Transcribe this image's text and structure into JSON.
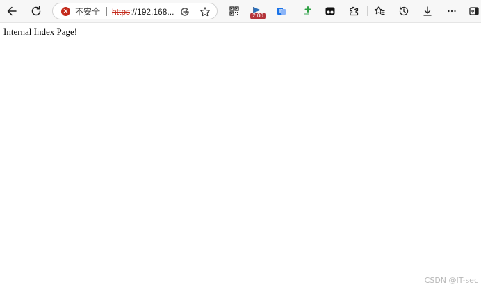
{
  "toolbar": {
    "back_icon": "arrow-left-icon",
    "refresh_icon": "refresh-icon",
    "address_bar": {
      "security_icon": "not-secure-icon",
      "security_label": "不安全",
      "url_scheme": "https",
      "url_rest": "://192.168...",
      "read_aloud_icon": "read-aloud-icon",
      "favorite_icon": "star-icon"
    },
    "extensions": [
      {
        "name": "qr-code-icon"
      },
      {
        "name": "flag-extension-icon",
        "badge": "2.00"
      },
      {
        "name": "translate-extension-icon"
      },
      {
        "name": "puzzle-plus-extension-icon"
      },
      {
        "name": "tampermonkey-icon"
      }
    ],
    "extensions_menu_icon": "puzzle-icon",
    "favorites_icon": "favorites-icon",
    "history_icon": "history-icon",
    "downloads_icon": "download-icon",
    "more_icon": "more-icon",
    "sidebar_icon": "sidebar-icon",
    "colors": {
      "security_red": "#c42b1c",
      "badge_red": "#b4343a",
      "translate_blue": "#1a73e8",
      "plus_green": "#2ea043"
    }
  },
  "page": {
    "body_text": "Internal Index Page!"
  },
  "watermark": "CSDN @IT-sec"
}
